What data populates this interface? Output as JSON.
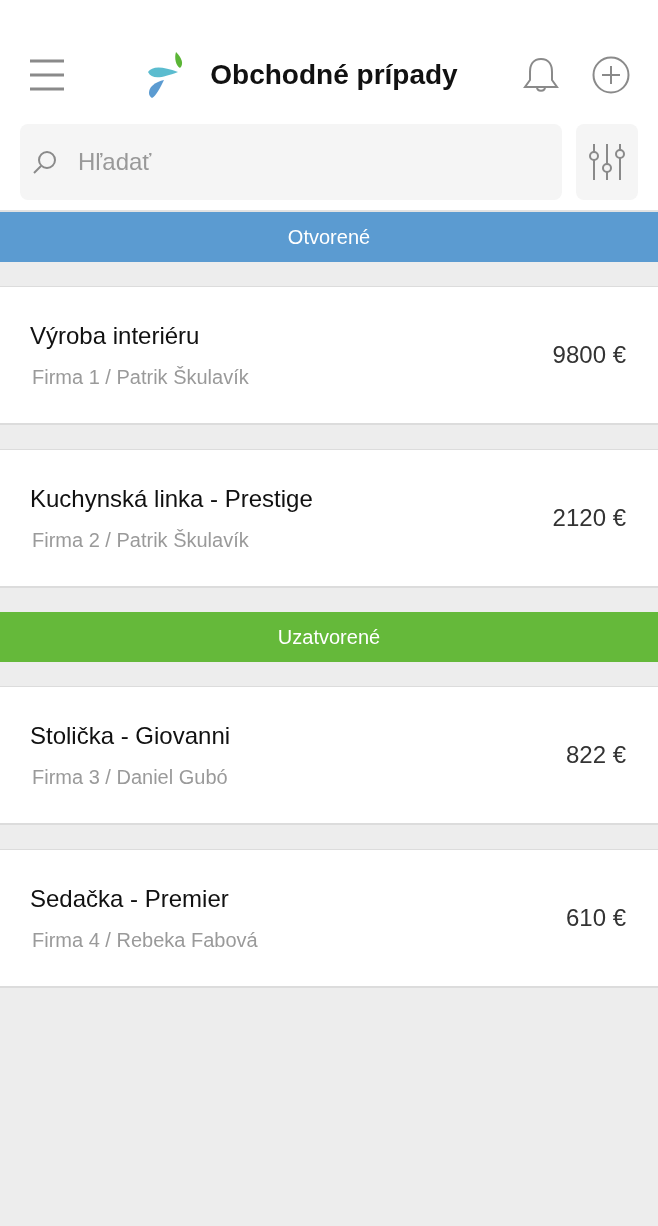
{
  "header": {
    "title": "Obchodné prípady"
  },
  "search": {
    "placeholder": "Hľadať"
  },
  "sections": [
    {
      "label": "Otvorené",
      "color": "#5b9bd1",
      "deals": [
        {
          "title": "Výroba interiéru",
          "subtitle": "Firma 1 / Patrik Škulavík",
          "amount": "9800 €"
        },
        {
          "title": "Kuchynská linka - Prestige",
          "subtitle": "Firma 2 / Patrik Škulavík",
          "amount": "2120 €"
        }
      ]
    },
    {
      "label": "Uzatvorené",
      "color": "#65b93a",
      "deals": [
        {
          "title": "Stolička - Giovanni",
          "subtitle": "Firma 3 / Daniel Gubó",
          "amount": "822 €"
        },
        {
          "title": "Sedačka - Premier",
          "subtitle": "Firma 4 / Rebeka Fabová",
          "amount": "610 €"
        }
      ]
    }
  ]
}
